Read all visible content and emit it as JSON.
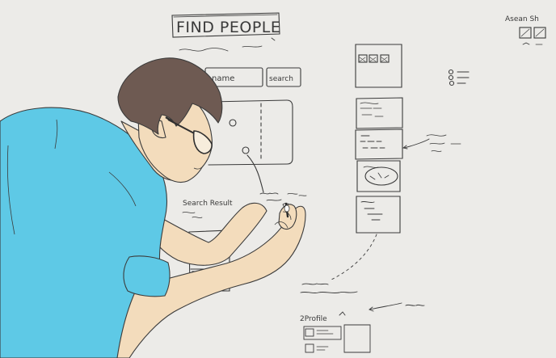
{
  "whiteboard": {
    "title": "FIND PEOPLE",
    "name_box": "name",
    "search_box": "search",
    "search_result_label": "Search Result",
    "top_right_label": "Asean Sh",
    "bottom_label": "2Profile"
  },
  "colors": {
    "background": "#ecebe8",
    "shirt": "#5ec9e6",
    "skin": "#f3dcbc",
    "hair": "#6e5a52",
    "ink": "#3a3a3a"
  }
}
